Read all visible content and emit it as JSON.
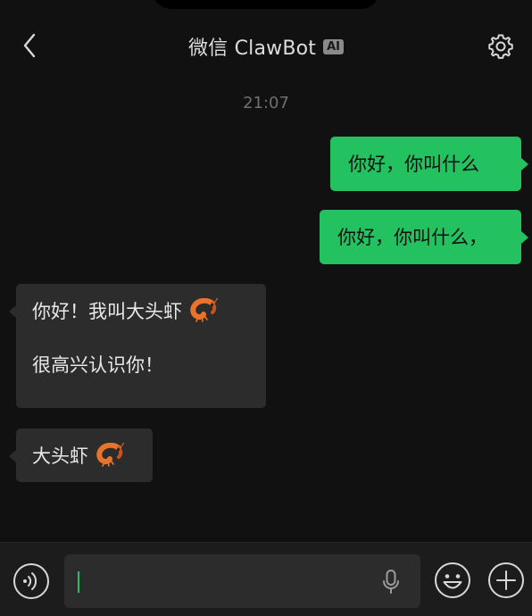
{
  "header": {
    "title": "微信 ClawBot",
    "badge": "AI",
    "back_icon": "chevron-left-icon",
    "settings_icon": "gear-icon"
  },
  "chat": {
    "timestamp": "21:07",
    "messages": [
      {
        "direction": "outgoing",
        "lines": [
          "你好，你叫什么"
        ]
      },
      {
        "direction": "outgoing",
        "lines": [
          "你好，你叫什么，"
        ]
      },
      {
        "direction": "incoming",
        "lines": [
          "你好！我叫大头虾",
          "很高兴认识你！"
        ],
        "emoji": "shrimp"
      },
      {
        "direction": "incoming",
        "lines": [
          "大头虾"
        ],
        "emoji": "shrimp"
      }
    ]
  },
  "input_bar": {
    "voice_icon": "voice-wave-icon",
    "input_value": "",
    "mic_icon": "microphone-icon",
    "emoji_icon": "smiley-face-icon",
    "plus_icon": "plus-circle-icon"
  },
  "colors": {
    "background": "#111111",
    "outgoing_bubble": "#23c160",
    "incoming_bubble": "#2c2c2c",
    "timestamp": "#6f6f6f"
  }
}
